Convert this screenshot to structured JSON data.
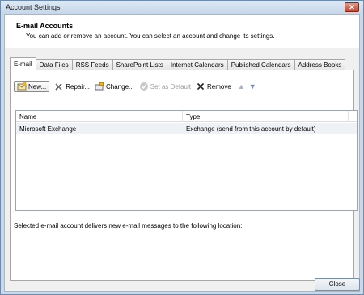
{
  "window": {
    "title": "Account Settings",
    "close_glyph": "✕"
  },
  "header": {
    "title": "E-mail Accounts",
    "subtitle": "You can add or remove an account. You can select an account and change its settings."
  },
  "tabs": [
    {
      "label": "E-mail",
      "active": true
    },
    {
      "label": "Data Files"
    },
    {
      "label": "RSS Feeds"
    },
    {
      "label": "SharePoint Lists"
    },
    {
      "label": "Internet Calendars"
    },
    {
      "label": "Published Calendars"
    },
    {
      "label": "Address Books"
    }
  ],
  "toolbar": {
    "new_label": "New...",
    "repair_label": "Repair...",
    "change_label": "Change...",
    "set_default_label": "Set as Default",
    "remove_label": "Remove",
    "icons": {
      "new": "new-mail-icon",
      "repair": "repair-tools-icon",
      "change": "change-icon",
      "set_default": "check-icon",
      "remove": "remove-x-icon",
      "move_up": "arrow-up-icon",
      "move_down": "arrow-down-icon"
    }
  },
  "accounts_table": {
    "columns": [
      "Name",
      "Type"
    ],
    "rows": [
      {
        "name": "Microsoft Exchange",
        "type": "Exchange (send from this account by default)"
      }
    ]
  },
  "location_text": "Selected e-mail account delivers new e-mail messages to the following location:",
  "footer": {
    "close_label": "Close"
  }
}
